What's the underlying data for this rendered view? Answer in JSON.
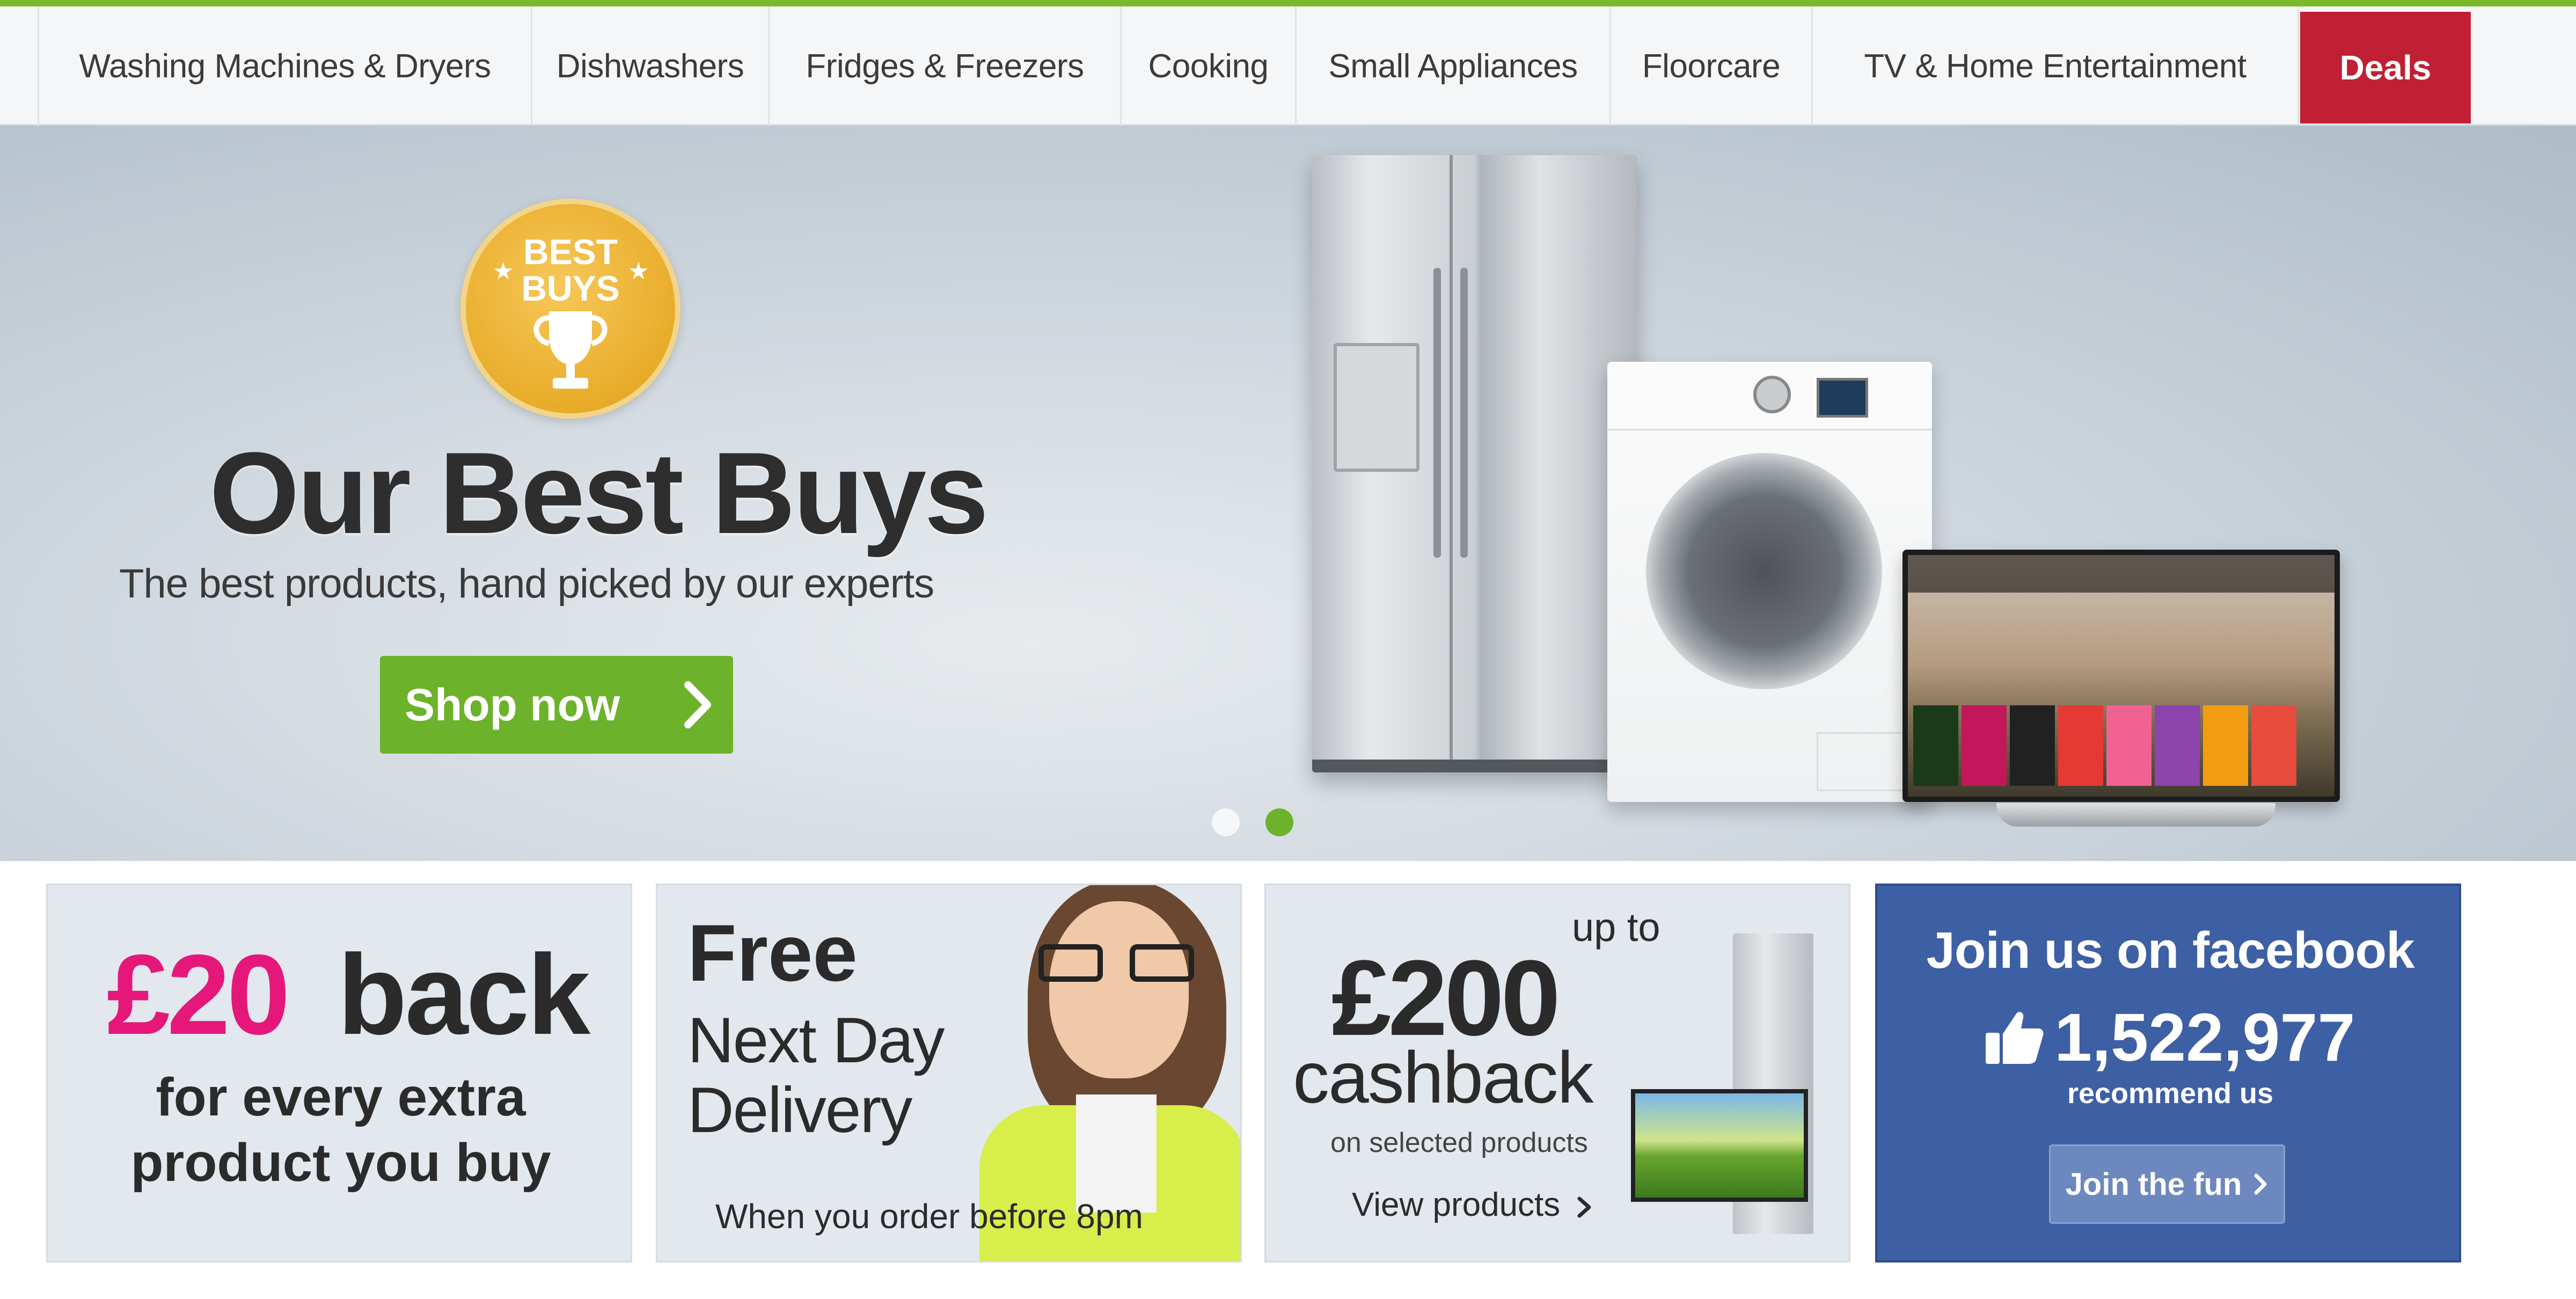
{
  "nav": {
    "items": [
      {
        "label": "Washing Machines & Dryers"
      },
      {
        "label": "Dishwashers"
      },
      {
        "label": "Fridges & Freezers"
      },
      {
        "label": "Cooking"
      },
      {
        "label": "Small Appliances"
      },
      {
        "label": "Floorcare"
      },
      {
        "label": "TV & Home Entertainment"
      }
    ],
    "deals_label": "Deals"
  },
  "hero": {
    "badge_line1": "BEST",
    "badge_line2": "BUYS",
    "title": "Our Best Buys",
    "subtitle": "The best products, hand picked by our experts",
    "button_label": "Shop now",
    "slide_count": 2,
    "active_slide": 2
  },
  "promos": {
    "cashback_extra": {
      "amount": "£20",
      "word": "back",
      "line1": "for every extra",
      "line2": "product you buy"
    },
    "delivery": {
      "line1": "Free",
      "line2": "Next Day",
      "line3": "Delivery",
      "note": "When you order before 8pm"
    },
    "cashback_200": {
      "prefix": "up to",
      "amount": "£200",
      "word": "cashback",
      "qualifier": "on selected products",
      "link_label": "View products"
    },
    "facebook": {
      "title": "Join us on facebook",
      "count": "1,522,977",
      "recommend": "recommend us",
      "button_label": "Join the fun"
    }
  },
  "colors": {
    "brand_green": "#6cb22a",
    "deals_red": "#c11f34",
    "promo_pink": "#e5187a",
    "facebook_blue": "#3d5fa4"
  },
  "icons": {
    "badge": "trophy-icon",
    "shop_arrow": "chevron-right-icon",
    "facebook": "thumbs-up-icon"
  }
}
